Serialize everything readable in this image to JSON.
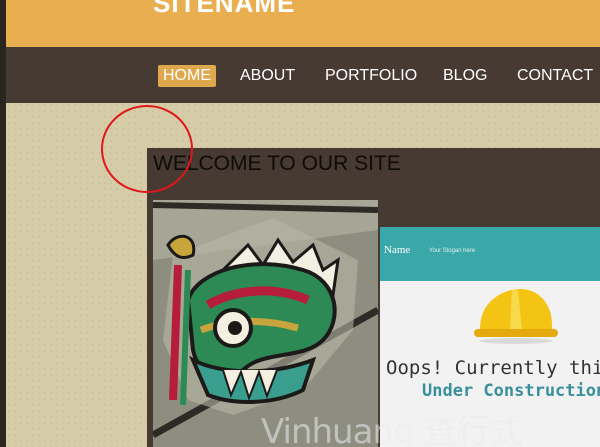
{
  "site": {
    "name": "SITENAME"
  },
  "nav": {
    "items": [
      {
        "label": "HOME",
        "active": true
      },
      {
        "label": "ABOUT"
      },
      {
        "label": "PORTFOLIO"
      },
      {
        "label": "BLOG"
      },
      {
        "label": "CONTACT"
      }
    ]
  },
  "main": {
    "heading": "WELCOME TO OUR SITE",
    "images": [
      {
        "type": "dragon-mural-photo"
      },
      {
        "type": "under-construction-preview",
        "site_name": "Name",
        "slogan": "Your Slogan here",
        "message_line1": "Oops! Currently this si",
        "message_line2": "Under Construction",
        "icon": "hard-hat-icon"
      }
    ]
  },
  "watermark": "Vinhuang 查行式",
  "colors": {
    "header": "#e8ae4f",
    "navbar": "#463a32",
    "nav_active": "#e0a84d",
    "background": "#d6cda8",
    "highlight_circle": "#e0161b",
    "construction_teal": "#3aa7a8"
  }
}
